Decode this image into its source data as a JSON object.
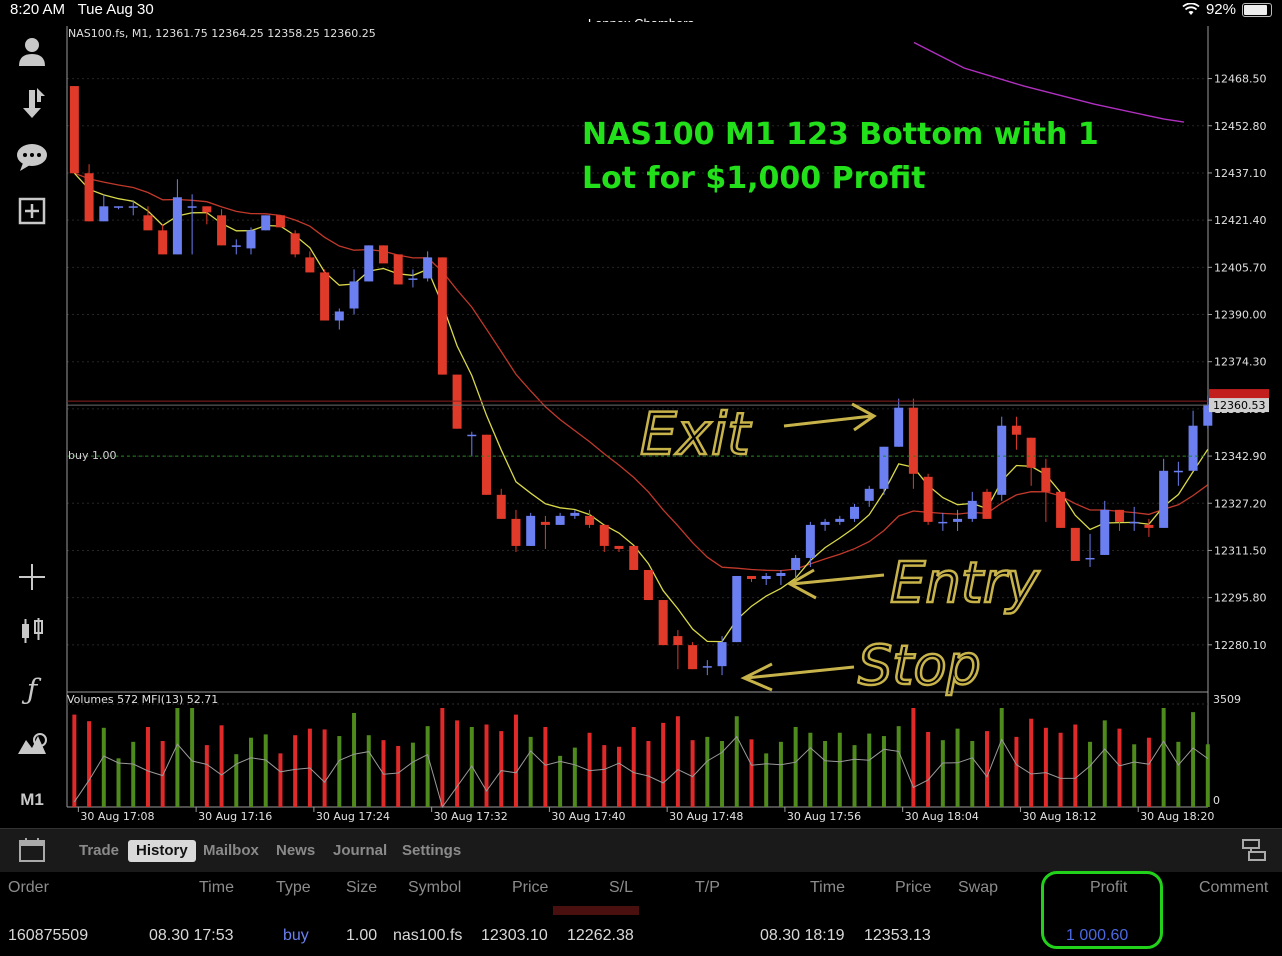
{
  "status_bar": {
    "time": "8:20 AM",
    "date": "Tue Aug 30",
    "center_title": "Lennox Chambers",
    "battery": "92%",
    "battery_level": 0.92
  },
  "sidebar": {
    "timeframe": "M1"
  },
  "chart": {
    "header": "NAS100.fs, M1, 12361.75 12364.25 12358.25 12360.25",
    "annotation_line1": "NAS100 M1 123 Bottom with 1",
    "annotation_line2": "Lot for $1,000 Profit",
    "order_line_label": "buy 1.00",
    "current_price_label": "12360.53",
    "volume_header": "Volumes 572 MFI(13) 52.71",
    "volume_axis_top": "3509",
    "volume_axis_bottom": "0",
    "handwritten": {
      "exit": "Exit",
      "entry": "Entry",
      "stop": "Stop"
    },
    "colors": {
      "bull": "#6b7ff0",
      "bear": "#e03a2a",
      "ma_fast": "#d8d84a",
      "ma_slow": "#c0392b",
      "ma_long": "#b030c0",
      "vol_up": "#4f8a1c",
      "vol_down": "#e02a2a",
      "annotation": "#22e01a",
      "handwriting": "#c7b34a"
    }
  },
  "chart_data": {
    "type": "candlestick",
    "price_axis": [
      "12468.50",
      "12452.80",
      "12437.10",
      "12421.40",
      "12405.70",
      "12390.00",
      "12374.30",
      "12358.60",
      "12342.90",
      "12327.20",
      "12311.50",
      "12295.80",
      "12280.10"
    ],
    "ylim": [
      12264.4,
      12480
    ],
    "time_labels": [
      "30 Aug 17:08",
      "30 Aug 17:16",
      "30 Aug 17:24",
      "30 Aug 17:32",
      "30 Aug 17:40",
      "30 Aug 17:48",
      "30 Aug 17:56",
      "30 Aug 18:04",
      "30 Aug 18:12",
      "30 Aug 18:20"
    ],
    "order_price": 12342.9,
    "current_price": 12360.53,
    "candles": [
      [
        12466,
        12466,
        12437,
        12437
      ],
      [
        12437,
        12440,
        12421,
        12421
      ],
      [
        12421,
        12430,
        12421,
        12426
      ],
      [
        12426,
        12426,
        12425,
        12426
      ],
      [
        12426,
        12428,
        12423,
        12426
      ],
      [
        12423,
        12426,
        12418,
        12418
      ],
      [
        12418,
        12420,
        12410,
        12410
      ],
      [
        12410,
        12435,
        12410,
        12429
      ],
      [
        12426,
        12430,
        12410,
        12426
      ],
      [
        12426,
        12426,
        12420,
        12424
      ],
      [
        12423,
        12425,
        12413,
        12413
      ],
      [
        12413,
        12415,
        12410,
        12413
      ],
      [
        12412,
        12419,
        12410,
        12418
      ],
      [
        12418,
        12423,
        12418,
        12423
      ],
      [
        12423,
        12423,
        12419,
        12419
      ],
      [
        12417,
        12418,
        12409,
        12410
      ],
      [
        12409,
        12411,
        12404,
        12404
      ],
      [
        12404,
        12405,
        12388,
        12388
      ],
      [
        12388,
        12392,
        12385,
        12391
      ],
      [
        12392,
        12405,
        12390,
        12401
      ],
      [
        12401,
        12413,
        12401,
        12413
      ],
      [
        12413,
        12413,
        12410,
        12407
      ],
      [
        12410,
        12410,
        12400,
        12400
      ],
      [
        12402,
        12405,
        12399,
        12402
      ],
      [
        12402,
        12411,
        12401,
        12409
      ],
      [
        12409,
        12409,
        12370,
        12370
      ],
      [
        12370,
        12370,
        12352,
        12352
      ],
      [
        12350,
        12351,
        12343,
        12350
      ],
      [
        12350,
        12350,
        12330,
        12330
      ],
      [
        12330,
        12332,
        12322,
        12322
      ],
      [
        12322,
        12325,
        12311,
        12313
      ],
      [
        12313,
        12324,
        12313,
        12323
      ],
      [
        12321,
        12323,
        12312,
        12320
      ],
      [
        12320,
        12324,
        12320,
        12323
      ],
      [
        12323,
        12325,
        12322,
        12324
      ],
      [
        12323,
        12325,
        12319,
        12320
      ],
      [
        12320,
        12320,
        12311,
        12313
      ],
      [
        12313,
        12313,
        12311,
        12312
      ],
      [
        12313,
        12313,
        12305,
        12305
      ],
      [
        12305,
        12305,
        12295,
        12295
      ],
      [
        12295,
        12295,
        12280,
        12280
      ],
      [
        12283,
        12285,
        12272,
        12280
      ],
      [
        12280,
        12281,
        12272,
        12272
      ],
      [
        12273,
        12275,
        12270,
        12273
      ],
      [
        12273,
        12283,
        12270,
        12281
      ],
      [
        12281,
        12303,
        12281,
        12303
      ],
      [
        12303,
        12303,
        12301,
        12302
      ],
      [
        12302,
        12304,
        12300,
        12303
      ],
      [
        12303,
        12305,
        12300,
        12304
      ],
      [
        12305,
        12310,
        12302,
        12309
      ],
      [
        12309,
        12321,
        12306,
        12320
      ],
      [
        12320,
        12322,
        12318,
        12321
      ],
      [
        12321,
        12323,
        12320,
        12322
      ],
      [
        12322,
        12327,
        12321,
        12326
      ],
      [
        12328,
        12333,
        12326,
        12332
      ],
      [
        12332,
        12346,
        12330,
        12346
      ],
      [
        12346,
        12362,
        12346,
        12359
      ],
      [
        12359,
        12362,
        12332,
        12337
      ],
      [
        12336,
        12337,
        12320,
        12321
      ],
      [
        12321,
        12324,
        12318,
        12321
      ],
      [
        12321,
        12325,
        12318,
        12322
      ],
      [
        12322,
        12331,
        12321,
        12328
      ],
      [
        12331,
        12332,
        12322,
        12322
      ],
      [
        12330,
        12356,
        12328,
        12353
      ],
      [
        12353,
        12356,
        12345,
        12350
      ],
      [
        12349,
        12349,
        12333,
        12339
      ],
      [
        12339,
        12342,
        12321,
        12331
      ],
      [
        12331,
        12331,
        12319,
        12319
      ],
      [
        12319,
        12319,
        12308,
        12308
      ],
      [
        12309,
        12317,
        12306,
        12309
      ],
      [
        12310,
        12328,
        12310,
        12325
      ],
      [
        12325,
        12325,
        12318,
        12321
      ],
      [
        12321,
        12326,
        12318,
        12321
      ],
      [
        12320,
        12322,
        12316,
        12319
      ],
      [
        12319,
        12342,
        12319,
        12338
      ],
      [
        12338,
        12341,
        12333,
        12338
      ],
      [
        12338,
        12358,
        12338,
        12353
      ],
      [
        12353,
        12363,
        12352,
        12360
      ]
    ]
  },
  "tabs": [
    "Trade",
    "History",
    "Mailbox",
    "News",
    "Journal",
    "Settings"
  ],
  "active_tab": "History",
  "table": {
    "headers": {
      "order": "Order",
      "time": "Time",
      "type": "Type",
      "size": "Size",
      "symbol": "Symbol",
      "price": "Price",
      "sl": "S/L",
      "tp": "T/P",
      "close_time": "Time",
      "close_price": "Price",
      "swap": "Swap",
      "profit": "Profit",
      "comment": "Comment"
    },
    "row": {
      "order": "160875509",
      "time": "08.30 17:53",
      "type": "buy",
      "size": "1.00",
      "symbol": "nas100.fs",
      "price": "12303.10",
      "sl": "12262.38",
      "tp": "",
      "close_time": "08.30 18:19",
      "close_price": "12353.13",
      "swap": "",
      "profit": "1 000.60",
      "comment": ""
    }
  }
}
